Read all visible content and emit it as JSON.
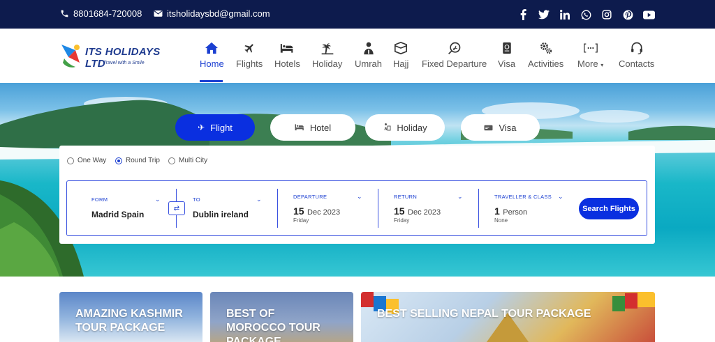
{
  "topbar": {
    "phone": "8801684-720008",
    "email": "itsholidaysbd@gmail.com",
    "social": [
      {
        "icon": "facebook-icon",
        "glyph": "f"
      },
      {
        "icon": "twitter-icon",
        "glyph": "t"
      },
      {
        "icon": "linkedin-icon",
        "glyph": "in"
      },
      {
        "icon": "whatsapp-icon",
        "glyph": "w"
      },
      {
        "icon": "instagram-icon",
        "glyph": "ig"
      },
      {
        "icon": "pinterest-icon",
        "glyph": "p"
      },
      {
        "icon": "youtube-icon",
        "glyph": "yt"
      }
    ]
  },
  "logo": {
    "brand": "ITS HOLIDAYS LTD",
    "tagline": "Travel with a Smile"
  },
  "nav": {
    "items": [
      {
        "label": "Home",
        "icon": "home-icon",
        "active": true
      },
      {
        "label": "Flights",
        "icon": "airplane-icon"
      },
      {
        "label": "Hotels",
        "icon": "bed-icon"
      },
      {
        "label": "Holiday",
        "icon": "palm-tree-icon"
      },
      {
        "label": "Umrah",
        "icon": "pilgrim-icon"
      },
      {
        "label": "Hajj",
        "icon": "kaaba-icon"
      },
      {
        "label": "Fixed Departure",
        "icon": "departure-icon"
      },
      {
        "label": "Visa",
        "icon": "passport-icon"
      },
      {
        "label": "Activities",
        "icon": "gears-icon"
      },
      {
        "label": "More",
        "icon": "ellipsis-icon"
      },
      {
        "label": "Contacts",
        "icon": "headset-icon"
      }
    ]
  },
  "tabs": [
    {
      "label": "Flight",
      "icon": "airplane-icon",
      "active": true
    },
    {
      "label": "Hotel",
      "icon": "bed-icon"
    },
    {
      "label": "Holiday",
      "icon": "holiday-icon"
    },
    {
      "label": "Visa",
      "icon": "passport-icon"
    }
  ],
  "trip_types": [
    {
      "label": "One Way",
      "checked": false
    },
    {
      "label": "Round Trip",
      "checked": true
    },
    {
      "label": "Multi City",
      "checked": false
    }
  ],
  "search": {
    "from": {
      "label": "FORM",
      "value": "Madrid Spain"
    },
    "to": {
      "label": "TO",
      "value": "Dublin ireland"
    },
    "departure": {
      "label": "DEPARTURE",
      "day": "15",
      "monthyear": "Dec 2023",
      "weekday": "Friday"
    },
    "return": {
      "label": "RETURN",
      "day": "15",
      "monthyear": "Dec 2023",
      "weekday": "Friday"
    },
    "traveller": {
      "label": "TRAVELLER & CLASS",
      "count": "1",
      "unit": "Person",
      "class": "None"
    },
    "button": "Search Flights"
  },
  "promos": [
    {
      "line1": "AMAZING KASHMIR",
      "line2": "TOUR PACKAGE",
      "line3": ""
    },
    {
      "line1": "BEST OF",
      "line2": "MOROCCO TOUR",
      "line3": "PACKAGE"
    },
    {
      "line1": "BEST SELLING NEPAL TOUR PACKAGE",
      "line2": "",
      "line3": ""
    }
  ],
  "colors": {
    "primary": "#0a2fe0",
    "topbar": "#0d1b4d",
    "accent_text": "#1b3fd1"
  }
}
